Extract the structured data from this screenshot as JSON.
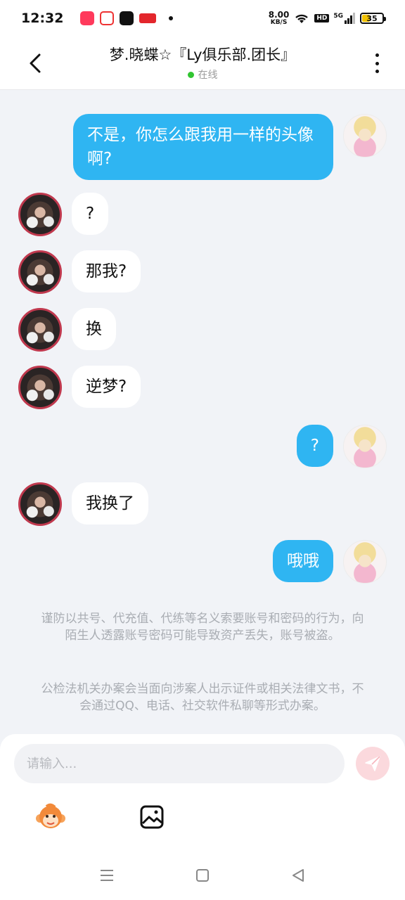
{
  "status_bar": {
    "time": "12:32",
    "net_speed_value": "8.00",
    "net_speed_unit": "KB/S",
    "hd_label": "HD",
    "signal_label": "5G",
    "battery": "35"
  },
  "header": {
    "back_icon": "chevron-left-icon",
    "title": "梦.晓蝶☆『Ly俱乐部.团长』",
    "presence": "在线",
    "presence_color": "#31c531",
    "more_icon": "more-vertical-icon"
  },
  "messages": [
    {
      "from": "me",
      "text": "不是，你怎么跟我用一样的头像啊?"
    },
    {
      "from": "peer",
      "text": "?"
    },
    {
      "from": "peer",
      "text": "那我?"
    },
    {
      "from": "peer",
      "text": "换"
    },
    {
      "from": "peer",
      "text": "逆梦?"
    },
    {
      "from": "me",
      "text": "?"
    },
    {
      "from": "peer",
      "text": "我换了"
    },
    {
      "from": "me",
      "text": "哦哦"
    }
  ],
  "notices": [
    "谨防以共号、代充值、代练等名义索要账号和密码的行为，向陌生人透露账号密码可能导致资产丢失，账号被盗。",
    "公检法机关办案会当面向涉案人出示证件或相关法律文书，不会通过QQ、电话、社交软件私聊等形式办案。"
  ],
  "composer": {
    "placeholder": "请输入...",
    "value": "",
    "send_icon": "paper-plane-icon",
    "tools": [
      "monkey-emoji-icon",
      "image-icon"
    ]
  },
  "nav_bar": {
    "icons": [
      "menu-icon",
      "home-square-icon",
      "back-triangle-icon"
    ]
  },
  "colors": {
    "my_bubble": "#2fb5f2",
    "peer_bubble": "#ffffff",
    "background": "#f1f3f7",
    "send_button": "#fbd9dd"
  }
}
